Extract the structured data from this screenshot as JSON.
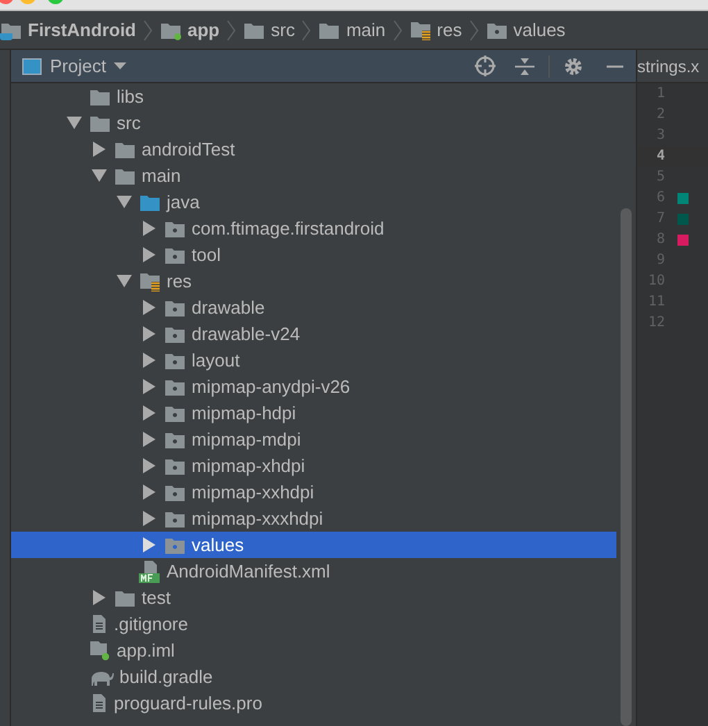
{
  "breadcrumbs": [
    {
      "label": "FirstAndroid",
      "kind": "project"
    },
    {
      "label": "app",
      "kind": "module"
    },
    {
      "label": "src",
      "kind": "folder"
    },
    {
      "label": "main",
      "kind": "folder"
    },
    {
      "label": "res",
      "kind": "res-folder"
    },
    {
      "label": "values",
      "kind": "package"
    }
  ],
  "project_panel": {
    "title": "Project",
    "tree": [
      {
        "label": "libs",
        "kind": "folder",
        "selected": false
      },
      {
        "label": "src",
        "kind": "folder",
        "expanded": true,
        "selected": false,
        "children": [
          {
            "label": "androidTest",
            "kind": "folder",
            "expanded": false,
            "selected": false
          },
          {
            "label": "main",
            "kind": "folder",
            "expanded": true,
            "selected": false,
            "children": [
              {
                "label": "java",
                "kind": "source-folder",
                "expanded": true,
                "selected": false,
                "children": [
                  {
                    "label": "com.ftimage.firstandroid",
                    "kind": "package",
                    "expanded": false,
                    "selected": false
                  },
                  {
                    "label": "tool",
                    "kind": "package",
                    "expanded": false,
                    "selected": false
                  }
                ]
              },
              {
                "label": "res",
                "kind": "res-folder",
                "expanded": true,
                "selected": false,
                "children": [
                  {
                    "label": "drawable",
                    "kind": "package",
                    "expanded": false,
                    "selected": false
                  },
                  {
                    "label": "drawable-v24",
                    "kind": "package",
                    "expanded": false,
                    "selected": false
                  },
                  {
                    "label": "layout",
                    "kind": "package",
                    "expanded": false,
                    "selected": false
                  },
                  {
                    "label": "mipmap-anydpi-v26",
                    "kind": "package",
                    "expanded": false,
                    "selected": false
                  },
                  {
                    "label": "mipmap-hdpi",
                    "kind": "package",
                    "expanded": false,
                    "selected": false
                  },
                  {
                    "label": "mipmap-mdpi",
                    "kind": "package",
                    "expanded": false,
                    "selected": false
                  },
                  {
                    "label": "mipmap-xhdpi",
                    "kind": "package",
                    "expanded": false,
                    "selected": false
                  },
                  {
                    "label": "mipmap-xxhdpi",
                    "kind": "package",
                    "expanded": false,
                    "selected": false
                  },
                  {
                    "label": "mipmap-xxxhdpi",
                    "kind": "package",
                    "expanded": false,
                    "selected": false
                  },
                  {
                    "label": "values",
                    "kind": "package",
                    "expanded": false,
                    "selected": true
                  }
                ]
              },
              {
                "label": "AndroidManifest.xml",
                "kind": "manifest",
                "selected": false
              }
            ]
          },
          {
            "label": "test",
            "kind": "folder",
            "expanded": false,
            "selected": false
          }
        ]
      },
      {
        "label": ".gitignore",
        "kind": "file",
        "selected": false
      },
      {
        "label": "app.iml",
        "kind": "module-file",
        "selected": false
      },
      {
        "label": "build.gradle",
        "kind": "gradle",
        "selected": false
      },
      {
        "label": "proguard-rules.pro",
        "kind": "file",
        "selected": false
      }
    ]
  },
  "editor": {
    "tab": "strings.x",
    "lines": [
      {
        "number": "1",
        "current": false
      },
      {
        "number": "2",
        "current": false
      },
      {
        "number": "3",
        "current": false
      },
      {
        "number": "4",
        "current": true
      },
      {
        "number": "5",
        "current": false
      },
      {
        "number": "6",
        "current": false,
        "color": "#008577"
      },
      {
        "number": "7",
        "current": false,
        "color": "#00574b"
      },
      {
        "number": "8",
        "current": false,
        "color": "#d81b60"
      },
      {
        "number": "9",
        "current": false
      },
      {
        "number": "10",
        "current": false
      },
      {
        "number": "11",
        "current": false
      },
      {
        "number": "12",
        "current": false
      }
    ]
  }
}
